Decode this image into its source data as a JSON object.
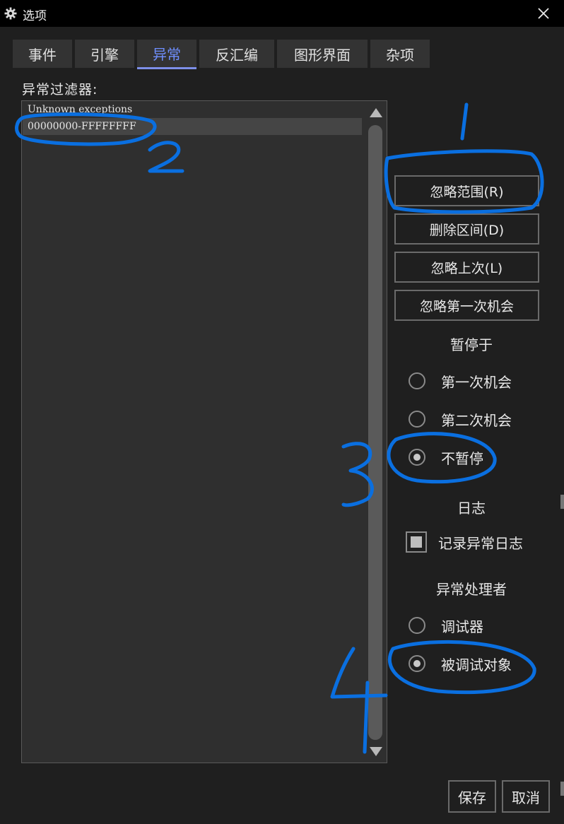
{
  "window": {
    "title": "选项"
  },
  "tabs": [
    {
      "label": "事件"
    },
    {
      "label": "引擎"
    },
    {
      "label": "异常",
      "active": true
    },
    {
      "label": "反汇编"
    },
    {
      "label": "图形界面"
    },
    {
      "label": "杂项"
    }
  ],
  "filter": {
    "label": "异常过滤器:",
    "items": [
      {
        "text": "Unknown exceptions"
      },
      {
        "text": "00000000-FFFFFFFF",
        "selected": true
      }
    ]
  },
  "actions": {
    "ignore_range": "忽略范围(R)",
    "delete_range": "删除区间(D)",
    "ignore_last": "忽略上次(L)",
    "ignore_first_chance": "忽略第一次机会"
  },
  "pause_on": {
    "title": "暂停于",
    "options": [
      "第一次机会",
      "第二次机会",
      "不暂停"
    ],
    "selected": "不暂停"
  },
  "log": {
    "title": "日志",
    "checkbox_label": "记录异常日志",
    "checked": true
  },
  "handler": {
    "title": "异常处理者",
    "options": [
      "调试器",
      "被调试对象"
    ],
    "selected": "被调试对象"
  },
  "footer": {
    "save": "保存",
    "cancel": "取消"
  },
  "colors": {
    "accent": "#6f8fff",
    "annotation": "#0a6fe0",
    "background": "#1f1f1f"
  },
  "annotations": [
    "1",
    "2",
    "3",
    "4"
  ]
}
